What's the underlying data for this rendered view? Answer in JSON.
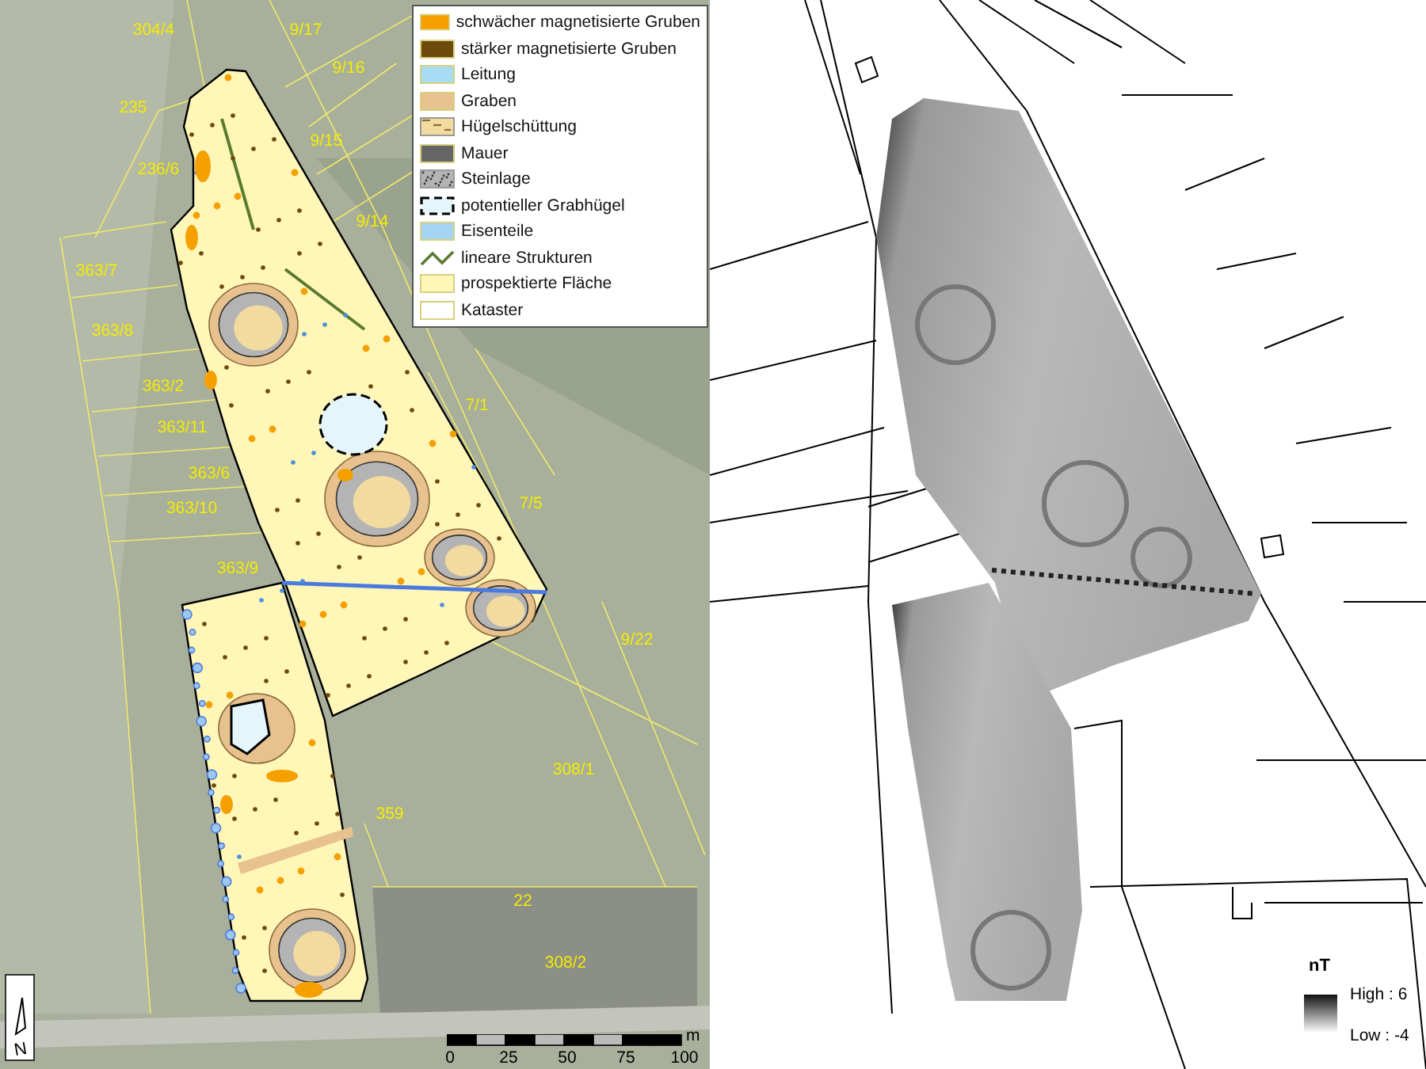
{
  "survey_map": {
    "parcels": [
      "304/4",
      "9/17",
      "9/16",
      "235",
      "9/15",
      "236/6",
      "9/14",
      "363/7",
      "363/8",
      "363/2",
      "363/11",
      "363/6",
      "363/10",
      "363/9",
      "7/1",
      "7/5",
      "9/22",
      "308/1",
      "359",
      "22",
      "308/2"
    ],
    "legend": [
      {
        "label": "schwächer magnetisierte Gruben",
        "kind": "fill",
        "color": "#f5a000"
      },
      {
        "label": "stärker magnetisierte Gruben",
        "kind": "fill",
        "color": "#6b4a0c"
      },
      {
        "label": "Leitung",
        "kind": "fill",
        "color": "#a7dcf3"
      },
      {
        "label": "Graben",
        "kind": "fill",
        "color": "#e8c28e"
      },
      {
        "label": "Hügelschüttung",
        "kind": "dotted",
        "color": "#f3dba0"
      },
      {
        "label": "Mauer",
        "kind": "fill",
        "color": "#666666"
      },
      {
        "label": "Steinlage",
        "kind": "stippled",
        "color": "#b4b4b4"
      },
      {
        "label": "potentieller Grabhügel",
        "kind": "dashed",
        "color": "#e4f6fc"
      },
      {
        "label": "Eisenteile",
        "kind": "fill",
        "color": "#a4d4f2"
      },
      {
        "label": "lineare Strukturen",
        "kind": "line",
        "color": "#5a7a2e"
      },
      {
        "label": "prospektierte Fläche",
        "kind": "fill",
        "color": "#fff6b8"
      },
      {
        "label": "Kataster",
        "kind": "fill",
        "color": "#ffffff"
      }
    ],
    "scale_bar": {
      "unit": "m",
      "ticks": [
        "0",
        "25",
        "50",
        "75",
        "100"
      ]
    },
    "north_arrow": {
      "label": "N"
    }
  },
  "magnetic_map": {
    "legend": {
      "title": "nT",
      "high": "High : 6",
      "low": "Low : -4"
    }
  }
}
